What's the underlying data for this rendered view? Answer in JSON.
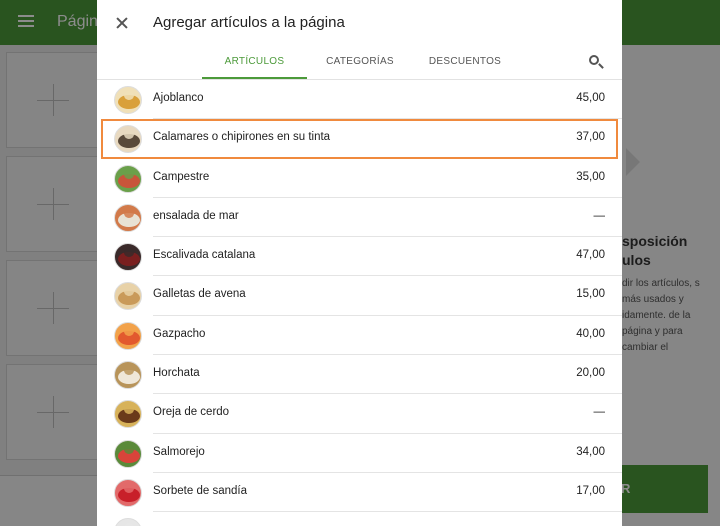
{
  "background": {
    "page_title": "Págin",
    "panel_heading_1": "sposición",
    "panel_heading_2": "ulos",
    "panel_text": "dir los artículos, s más usados y idamente. de la página y para cambiar el",
    "green_button": "R"
  },
  "dialog": {
    "title": "Agregar artículos a la página",
    "tabs": [
      {
        "label": "ARTÍCULOS",
        "active": true
      },
      {
        "label": "CATEGORÍAS",
        "active": false
      },
      {
        "label": "DESCUENTOS",
        "active": false
      }
    ],
    "items": [
      {
        "name": "Ajoblanco",
        "price": "45,00",
        "colors": [
          "#d9a03a",
          "#f0e0b8"
        ],
        "icon": "ajoblanco-thumb-icon"
      },
      {
        "name": "Calamares o chipirones en su tinta",
        "price": "37,00",
        "colors": [
          "#5a4a3a",
          "#e8d9c0"
        ],
        "icon": "calamares-thumb-icon",
        "highlight": true
      },
      {
        "name": "Campestre",
        "price": "35,00",
        "colors": [
          "#c8553a",
          "#6aa04a"
        ],
        "icon": "campestre-thumb-icon"
      },
      {
        "name": "ensalada de mar",
        "price": "—",
        "colors": [
          "#e8e2d4",
          "#d27a4a"
        ],
        "icon": "ensalada-thumb-icon"
      },
      {
        "name": "Escalivada catalana",
        "price": "47,00",
        "colors": [
          "#7a1f1f",
          "#3a2a2a"
        ],
        "icon": "escalivada-thumb-icon"
      },
      {
        "name": "Galletas de avena",
        "price": "15,00",
        "colors": [
          "#c99a5a",
          "#e8d2a8"
        ],
        "icon": "galletas-thumb-icon"
      },
      {
        "name": "Gazpacho",
        "price": "40,00",
        "colors": [
          "#e2592e",
          "#f2a24a"
        ],
        "icon": "gazpacho-thumb-icon"
      },
      {
        "name": "Horchata",
        "price": "20,00",
        "colors": [
          "#efe7d8",
          "#b8945a"
        ],
        "icon": "horchata-thumb-icon"
      },
      {
        "name": "Oreja de cerdo",
        "price": "—",
        "colors": [
          "#6a3a1a",
          "#d7b25a"
        ],
        "icon": "oreja-thumb-icon"
      },
      {
        "name": "Salmorejo",
        "price": "34,00",
        "colors": [
          "#d9443a",
          "#5a8a3a"
        ],
        "icon": "salmorejo-thumb-icon"
      },
      {
        "name": "Sorbete de sandía",
        "price": "17,00",
        "colors": [
          "#c8202a",
          "#e26a6a"
        ],
        "icon": "sorbete-thumb-icon"
      },
      {
        "name": "",
        "price": "",
        "colors": [
          "#cccccc",
          "#e6e6e6"
        ],
        "icon": "item-thumb-icon"
      }
    ]
  },
  "colors": {
    "accent": "#4c9a3a",
    "highlight": "#f08a3e"
  }
}
